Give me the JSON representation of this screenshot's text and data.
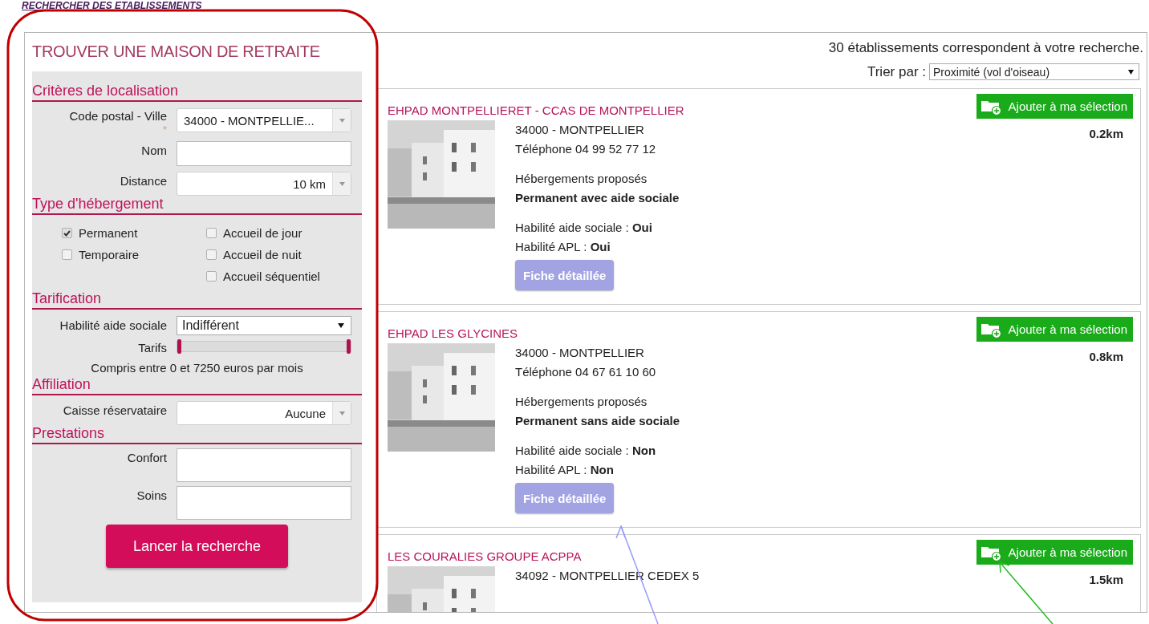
{
  "page_heading": "RECHERCHER DES ETABLISSEMENTS",
  "search_panel": {
    "title": "TROUVER UNE MAISON DE RETRAITE",
    "sections": [
      {
        "title": "Critères de localisation",
        "kind": "fields",
        "fields": [
          {
            "label": "Code postal - Ville",
            "kind": "autocomplete",
            "value": "34000 - MONTPELLIE...",
            "required_mark": "*"
          },
          {
            "label": "Nom",
            "kind": "text"
          },
          {
            "label": "Distance",
            "kind": "combo",
            "value": "10 km"
          }
        ]
      },
      {
        "title": "Type d'hébergement",
        "kind": "checkboxes",
        "columns": [
          [
            {
              "label": "Permanent",
              "checked": true
            },
            {
              "label": "Temporaire",
              "checked": false
            }
          ],
          [
            {
              "label": "Accueil de jour",
              "checked": false
            },
            {
              "label": "Accueil de nuit",
              "checked": false
            },
            {
              "label": "Accueil séquentiel",
              "checked": false
            }
          ]
        ]
      },
      {
        "title": "Tarification",
        "kind": "fields",
        "fields": [
          {
            "label": "Habilité aide sociale",
            "kind": "select",
            "value": "Indifférent"
          },
          {
            "label": "Tarifs",
            "kind": "range",
            "level": 1
          }
        ],
        "note": "Compris entre 0 et 7250 euros par mois"
      },
      {
        "title": "Affiliation",
        "kind": "fields",
        "fields": [
          {
            "label": "Caisse réservataire",
            "kind": "combo",
            "value": "Aucune"
          }
        ]
      },
      {
        "title": "Prestations",
        "kind": "fields",
        "fields": [
          {
            "label": "Confort",
            "kind": "textarea"
          },
          {
            "label": "Soins",
            "kind": "textarea"
          }
        ]
      }
    ],
    "submit": "Lancer la recherche"
  },
  "results": {
    "count_text": "30 établissements correspondent à votre recherche.",
    "sort": {
      "label": "Trier par :",
      "value": "Proximité (vol d'oiseau)"
    },
    "items": [
      {
        "name": "EHPAD MONTPELLIERET - CCAS DE MONTPELLIER",
        "add_button": "Ajouter à ma sélection",
        "distance": "0.2km",
        "address": "34000 - MONTPELLIER",
        "phone": "Téléphone 04 99 52 77 12",
        "offer_label": "Hébergements proposés",
        "offer": "Permanent avec aide sociale",
        "aide_sociale": "Habilité aide sociale : **Oui**",
        "apl": "Habilité APL : **Oui**",
        "details_button": "Fiche détaillée"
      },
      {
        "name": "EHPAD LES GLYCINES",
        "add_button": "Ajouter à ma sélection",
        "distance": "0.8km",
        "address": "34000 - MONTPELLIER",
        "phone": "Téléphone 04 67 61 10 60",
        "offer_label": "Hébergements proposés",
        "offer": "Permanent sans aide sociale",
        "aide_sociale": "Habilité aide sociale : **Non**",
        "apl": "Habilité APL : **Non**",
        "details_button": "Fiche détaillée"
      },
      {
        "name": "LES COURALIES GROUPE ACPPA",
        "add_button": "Ajouter à ma sélection",
        "distance": "1.5km",
        "address": "34092 - MONTPELLIER CEDEX 5"
      }
    ]
  }
}
